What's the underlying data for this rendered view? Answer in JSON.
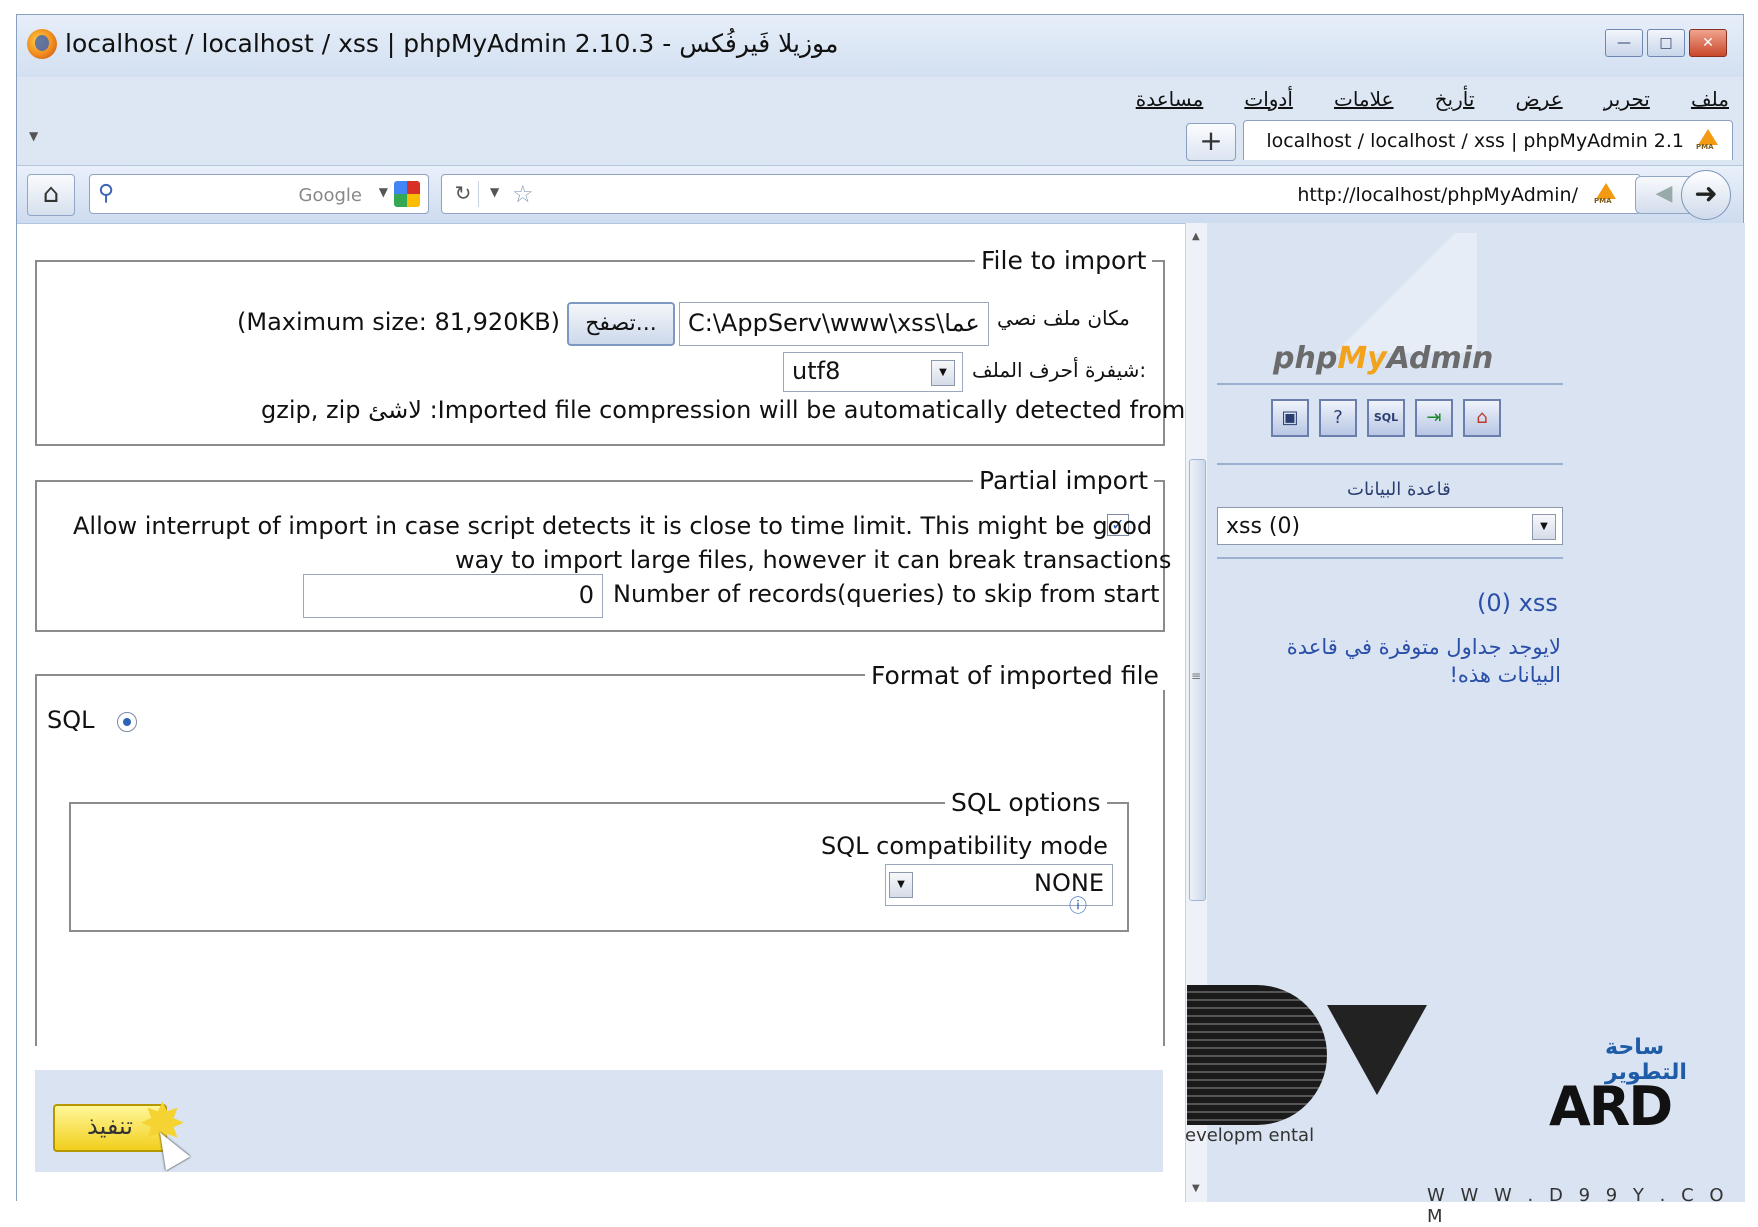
{
  "window": {
    "title": "localhost / localhost / xss | phpMyAdmin 2.10.3 - موزيلا فَيرفُكس",
    "controls": [
      "minimize",
      "maximize",
      "close"
    ]
  },
  "menu": {
    "file": "ملف",
    "edit": "تحرير",
    "view": "عرض",
    "history": "تأريخ",
    "bookmarks": "علامات",
    "tools": "أدوات",
    "help": "مساعدة"
  },
  "tabs": {
    "active_title": "localhost / localhost / xss | phpMyAdmin 2.1",
    "new_tab": "+"
  },
  "navbar": {
    "search_engine": "Google",
    "url": "http://localhost/phpMyAdmin/"
  },
  "import": {
    "file_legend": "File to import",
    "file_label": "مكان ملف نصي",
    "file_path": "C:\\AppServ\\www\\xss\\عما",
    "browse_label": "تصفح...",
    "max_size": "(Maximum size: 81,920KB)",
    "charset_label": "شيفرة أحرف الملف:",
    "charset_value": "utf8",
    "compression_note": "gzip, zip لاشئ :Imported file compression will be automatically detected from",
    "partial_legend": "Partial import",
    "interrupt_line1": "Allow interrupt of import in case script detects it is close to time limit. This might be good",
    "interrupt_line2": "way to import large files, however it can break transactions",
    "interrupt_checked": true,
    "skip_label": "Number of records(queries) to skip from start",
    "skip_value": "0",
    "format_legend": "Format of imported file",
    "format_sql": "SQL",
    "sql_options_legend": "SQL options",
    "compat_label": "SQL compatibility mode",
    "compat_value": "NONE",
    "go_label": "تنفيذ"
  },
  "sidebar": {
    "logo_php": "php",
    "logo_my": "My",
    "logo_admin": "Admin",
    "db_label": "قاعدة البيانات",
    "db_select": "xss (0)",
    "db_info": "(0) xss",
    "no_tables": "لايوجد جداول متوفرة في قاعدة البيانات هذه!"
  },
  "watermark": {
    "arabic": "ساحة التطوير",
    "text": "evelopm ental",
    "url": "W W W . D 9 9 Y . C O M",
    "logo": "ARD"
  }
}
